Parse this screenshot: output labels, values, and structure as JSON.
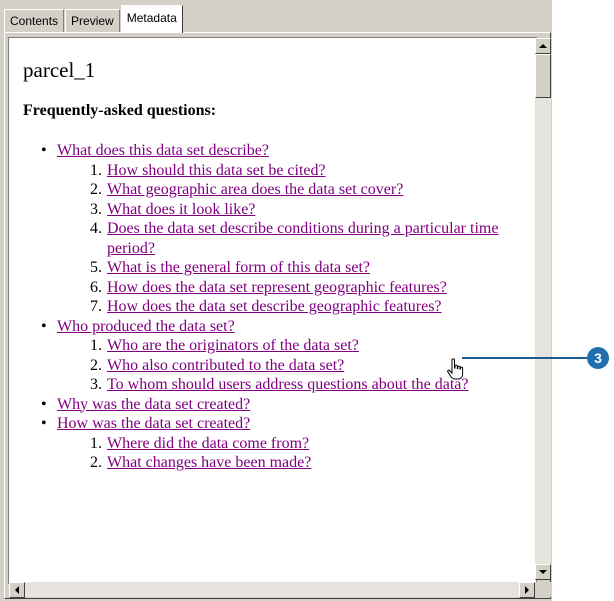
{
  "tabs": [
    {
      "label": "Contents"
    },
    {
      "label": "Preview"
    },
    {
      "label": "Metadata"
    }
  ],
  "doc": {
    "title": "parcel_1",
    "faq_heading": "Frequently-asked questions:",
    "topics": [
      {
        "label": "What does this data set describe?",
        "items": [
          {
            "num": "1.",
            "text": "How should this data set be cited?"
          },
          {
            "num": "2.",
            "text": "What geographic area does the data set cover?"
          },
          {
            "num": "3.",
            "text": "What does it look like?"
          },
          {
            "num": "4.",
            "text": "Does the data set describe conditions during a particular time period?"
          },
          {
            "num": "5.",
            "text": "What is the general form of this data set?"
          },
          {
            "num": "6.",
            "text": "How does the data set represent geographic features?"
          },
          {
            "num": "7.",
            "text": "How does the data set describe geographic features?"
          }
        ]
      },
      {
        "label": "Who produced the data set?",
        "items": [
          {
            "num": "1.",
            "text": "Who are the originators of the data set?"
          },
          {
            "num": "2.",
            "text": "Who also contributed to the data set?"
          },
          {
            "num": "3.",
            "text": "To whom should users address questions about the data?"
          }
        ]
      },
      {
        "label": "Why was the data set created?",
        "items": []
      },
      {
        "label": "How was the data set created?",
        "items": [
          {
            "num": "1.",
            "text": "Where did the data come from?"
          },
          {
            "num": "2.",
            "text": "What changes have been made?"
          }
        ]
      }
    ]
  },
  "callout": {
    "number": "3"
  },
  "icons": {
    "scroll_up": "triangle-up-icon",
    "scroll_down": "triangle-down-icon",
    "scroll_left": "triangle-left-icon",
    "scroll_right": "triangle-right-icon",
    "pointer": "hand-pointer-icon"
  },
  "colors": {
    "link": "#800080",
    "callout": "#1f6fae",
    "chrome": "#d4d0c8"
  }
}
